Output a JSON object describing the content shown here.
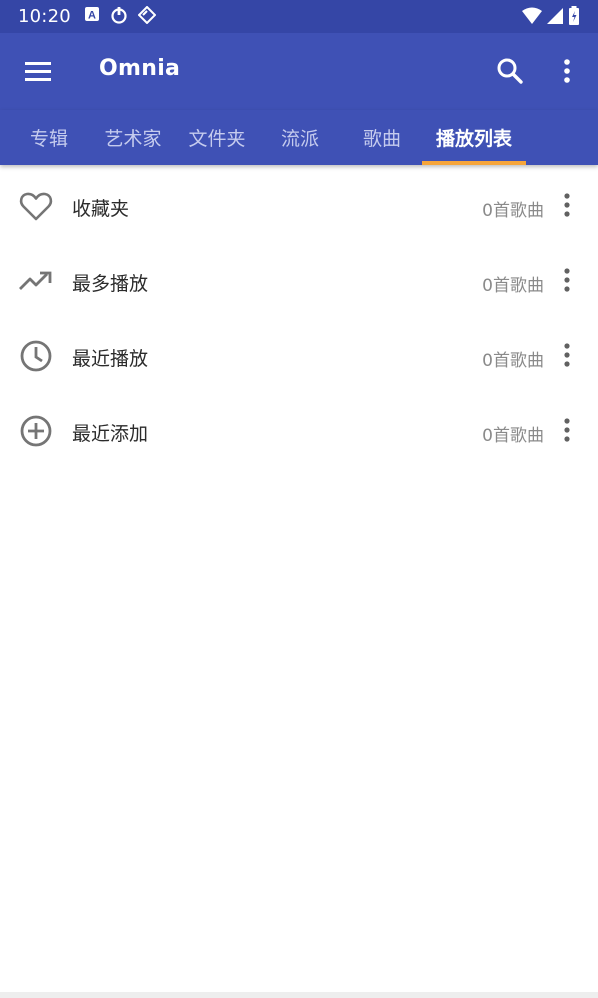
{
  "status_bar": {
    "time": "10:20",
    "left_icons": [
      "a-letter-icon",
      "sync-icon",
      "tag-icon"
    ],
    "right_icons": [
      "wifi-icon",
      "cell-signal-icon",
      "battery-icon"
    ]
  },
  "app_bar": {
    "title": "Omnia",
    "icons": [
      "hamburger-menu-icon",
      "search-icon",
      "more-vert-icon"
    ]
  },
  "tabs": [
    {
      "label": "专辑",
      "active": false
    },
    {
      "label": "艺术家",
      "active": false
    },
    {
      "label": "文件夹",
      "active": false
    },
    {
      "label": "流派",
      "active": false
    },
    {
      "label": "歌曲",
      "active": false
    },
    {
      "label": "播放列表",
      "active": true
    }
  ],
  "playlists": [
    {
      "icon": "heart-icon",
      "label": "收藏夹",
      "count": "0首歌曲"
    },
    {
      "icon": "trending-up-icon",
      "label": "最多播放",
      "count": "0首歌曲"
    },
    {
      "icon": "clock-icon",
      "label": "最近播放",
      "count": "0首歌曲"
    },
    {
      "icon": "add-circle-icon",
      "label": "最近添加",
      "count": "0首歌曲"
    }
  ],
  "colors": {
    "status_bar": "#3546a6",
    "primary": "#3f51b5",
    "tab_indicator": "#f6a53a",
    "icon_gray": "#757575"
  }
}
